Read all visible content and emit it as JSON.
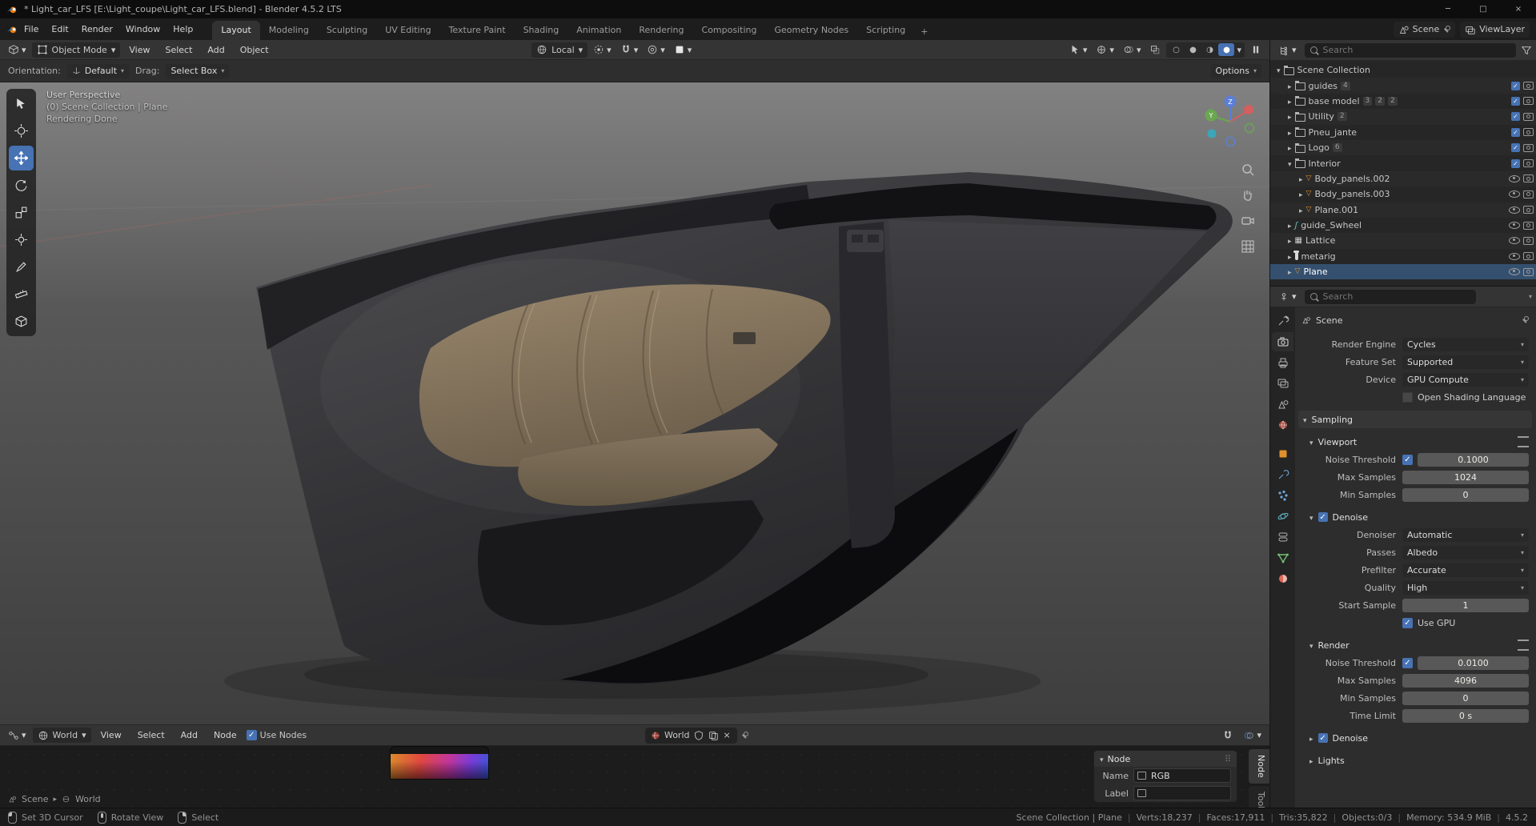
{
  "colors": {
    "accent": "#4772b3",
    "object_orange": "#e0902c",
    "data_green": "#71c171",
    "modifier_blue": "#6fa8dc",
    "viewport_bg": "#4a4a4a"
  },
  "titlebar": {
    "title": "* Light_car_LFS [E:\\Light_coupe\\Light_car_LFS.blend] - Blender 4.5.2 LTS",
    "minimize": "─",
    "maximize": "□",
    "close": "×"
  },
  "topbar": {
    "menus": [
      "File",
      "Edit",
      "Render",
      "Window",
      "Help"
    ],
    "workspaces": [
      {
        "label": "Layout",
        "active": true
      },
      {
        "label": "Modeling"
      },
      {
        "label": "Sculpting"
      },
      {
        "label": "UV Editing"
      },
      {
        "label": "Texture Paint"
      },
      {
        "label": "Shading"
      },
      {
        "label": "Animation"
      },
      {
        "label": "Rendering"
      },
      {
        "label": "Compositing"
      },
      {
        "label": "Geometry Nodes"
      },
      {
        "label": "Scripting"
      }
    ],
    "add_workspace": "+",
    "scene_label": "Scene",
    "viewlayer_label": "ViewLayer"
  },
  "viewport_header": {
    "mode": "Object Mode",
    "menus": [
      "View",
      "Select",
      "Add",
      "Object"
    ],
    "orientation": "Local"
  },
  "tool_settings": {
    "orientation_label": "Orientation:",
    "orientation_value": "Default",
    "drag_label": "Drag:",
    "drag_value": "Select Box",
    "options_label": "Options"
  },
  "viewport": {
    "overlay_line1": "User Perspective",
    "overlay_line2": "(0) Scene Collection | Plane",
    "overlay_line3": "Rendering Done",
    "axis_z": "Z",
    "axis_y": "Y"
  },
  "outliner": {
    "search_placeholder": "Search",
    "root": {
      "name": "Scene Collection",
      "state": "open"
    },
    "items": [
      {
        "name": "guides",
        "state": "closed",
        "kind": "collection",
        "controls": "collection",
        "badges": [
          "4"
        ]
      },
      {
        "name": "base model",
        "state": "closed",
        "kind": "collection",
        "controls": "collection",
        "badges": [
          "3",
          "2",
          "2"
        ]
      },
      {
        "name": "Utility",
        "state": "closed",
        "kind": "collection",
        "controls": "collection",
        "badges": [
          "2"
        ]
      },
      {
        "name": "Pneu_jante",
        "state": "closed",
        "kind": "collection",
        "controls": "collection",
        "badges": []
      },
      {
        "name": "Logo",
        "state": "closed",
        "kind": "collection",
        "controls": "collection",
        "badges": [
          "6"
        ]
      },
      {
        "name": "Interior",
        "state": "open",
        "kind": "collection",
        "controls": "collection",
        "badges": []
      },
      {
        "name": "Body_panels.002",
        "state": "closed",
        "kind": "mesh",
        "controls": "object",
        "dim": true
      },
      {
        "name": "Body_panels.003",
        "state": "closed",
        "kind": "mesh",
        "controls": "object"
      },
      {
        "name": "Plane.001",
        "state": "closed",
        "kind": "mesh",
        "controls": "object"
      },
      {
        "name": "guide_Swheel",
        "state": "closed",
        "kind": "curve",
        "controls": "object"
      },
      {
        "name": "Lattice",
        "state": "closed",
        "kind": "lattice",
        "controls": "object"
      },
      {
        "name": "metarig",
        "state": "closed",
        "kind": "armature",
        "controls": "object"
      },
      {
        "name": "Plane",
        "state": "closed",
        "kind": "mesh",
        "controls": "object",
        "selected": true
      }
    ]
  },
  "properties": {
    "search_placeholder": "Search",
    "breadcrumb": "Scene",
    "render_engine_label": "Render Engine",
    "render_engine_value": "Cycles",
    "feature_set_label": "Feature Set",
    "feature_set_value": "Supported",
    "device_label": "Device",
    "device_value": "GPU Compute",
    "osl_label": "Open Shading Language",
    "osl_checked": false,
    "sampling_title": "Sampling",
    "viewport_title": "Viewport",
    "vp_noise_label": "Noise Threshold",
    "vp_noise_checked": true,
    "vp_noise_value": "0.1000",
    "vp_max_label": "Max Samples",
    "vp_max_value": "1024",
    "vp_min_label": "Min Samples",
    "vp_min_value": "0",
    "denoise_title": "Denoise",
    "denoise_checked": true,
    "denoiser_label": "Denoiser",
    "denoiser_value": "Automatic",
    "passes_label": "Passes",
    "passes_value": "Albedo",
    "prefilter_label": "Prefilter",
    "prefilter_value": "Accurate",
    "quality_label": "Quality",
    "quality_value": "High",
    "start_sample_label": "Start Sample",
    "start_sample_value": "1",
    "use_gpu_label": "Use GPU",
    "use_gpu_checked": true,
    "render_title": "Render",
    "r_noise_label": "Noise Threshold",
    "r_noise_checked": true,
    "r_noise_value": "0.0100",
    "r_max_label": "Max Samples",
    "r_max_value": "4096",
    "r_min_label": "Min Samples",
    "r_min_value": "0",
    "time_limit_label": "Time Limit",
    "time_limit_value": "0 s",
    "denoise2_title": "Denoise",
    "denoise2_checked": true,
    "lights_title": "Lights"
  },
  "shader_editor": {
    "type_value": "World",
    "menus": [
      "View",
      "Select",
      "Add",
      "Node"
    ],
    "use_nodes_label": "Use Nodes",
    "use_nodes_checked": true,
    "id_name": "World",
    "unlink": "×",
    "breadcrumb_scene": "Scene",
    "breadcrumb_world": "World",
    "node_panel_title": "Node",
    "name_label": "Name",
    "name_value": "RGB",
    "label_label": "Label",
    "label_value": "",
    "tabs": [
      {
        "label": "Node",
        "active": true
      },
      {
        "label": "Tool"
      }
    ]
  },
  "statusbar": {
    "left": [
      {
        "label": "Set 3D Cursor"
      },
      {
        "label": "Rotate View"
      },
      {
        "label": "Select"
      }
    ],
    "stats": [
      "Scene Collection | Plane",
      "Verts:18,237",
      "Faces:17,911",
      "Tris:35,822",
      "Objects:0/3",
      "Memory: 534.9 MiB",
      "4.5.2"
    ]
  }
}
